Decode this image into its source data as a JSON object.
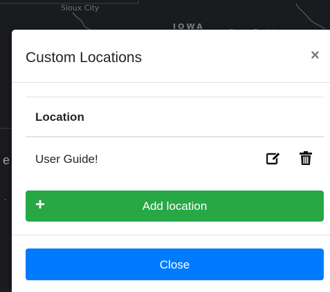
{
  "map": {
    "city_label": "Sioux City",
    "state_label": "IOWA",
    "city2_label": "Cedar Rapids",
    "edge_text": "e",
    "edge_dot": "."
  },
  "modal": {
    "title": "Custom Locations",
    "close_symbol": "×",
    "table": {
      "header_location": "Location",
      "rows": [
        {
          "name": "User Guide!",
          "edit_icon": "edit-icon",
          "delete_icon": "trash-icon"
        }
      ]
    },
    "add_button": {
      "icon": "+",
      "label": "Add location"
    },
    "close_button": {
      "label": "Close"
    }
  },
  "colors": {
    "success": "#28a745",
    "primary": "#007bff",
    "map_bg": "#1f2225"
  }
}
